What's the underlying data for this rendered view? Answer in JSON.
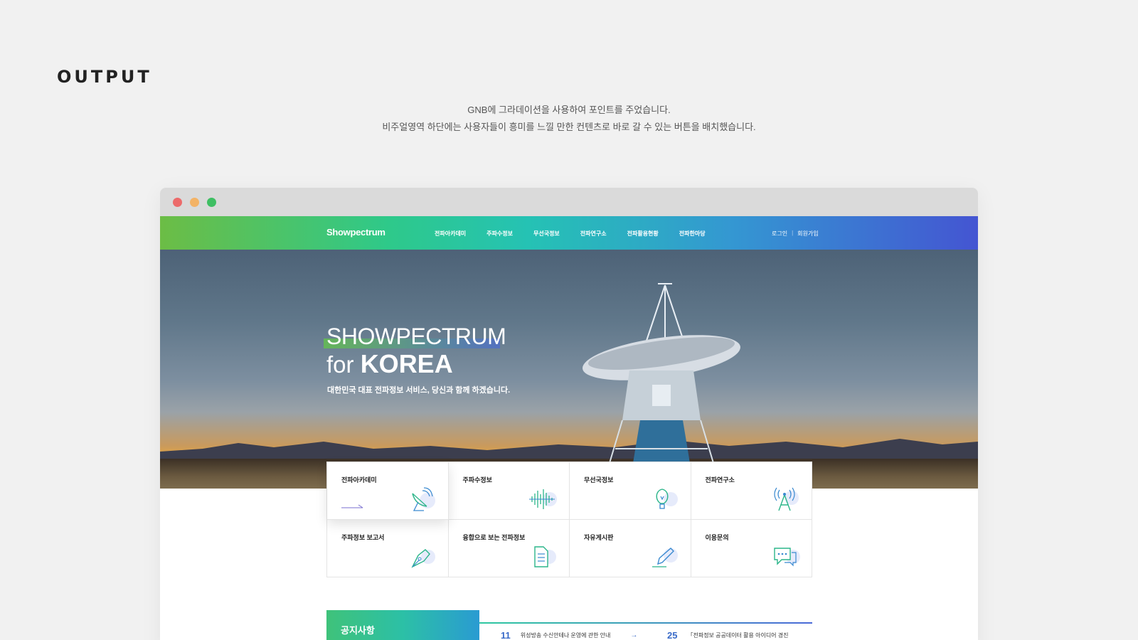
{
  "section": {
    "title": "OUTPUT",
    "desc_line1": "GNB에 그라데이션을 사용하여 포인트를 주었습니다.",
    "desc_line2": "비주얼영역 하단에는 사용자들이 흥미를 느낄 만한 컨텐츠로 바로 갈 수 있는 버튼을 배치했습니다."
  },
  "gnb": {
    "logo": "Showpectrum",
    "menu": [
      "전파아카데미",
      "주파수정보",
      "무선국정보",
      "전파연구소",
      "전파활용현황",
      "전파한마당"
    ],
    "login": "로그인",
    "separator": "|",
    "join": "회원가입"
  },
  "hero": {
    "title_line1": "SHOWPECTRUM",
    "title_for": "for ",
    "title_korea": "KOREA",
    "subtitle": "대한민국 대표 전파정보 서비스, 당신과 함께 하겠습니다."
  },
  "quick_menu": [
    {
      "label": "전파아카데미",
      "icon": "satellite-dish-icon"
    },
    {
      "label": "주파수정보",
      "icon": "waveform-icon"
    },
    {
      "label": "무선국정보",
      "icon": "lightbulb-icon"
    },
    {
      "label": "전파연구소",
      "icon": "antenna-tower-icon"
    },
    {
      "label": "주파정보 보고서",
      "icon": "pen-nib-icon"
    },
    {
      "label": "융합으로 보는 전파정보",
      "icon": "document-icon"
    },
    {
      "label": "자유게시판",
      "icon": "pencil-icon"
    },
    {
      "label": "이용문의",
      "icon": "chat-bubbles-icon"
    }
  ],
  "notice": {
    "title": "공지사항",
    "items": [
      {
        "day": "11",
        "text": "위성방송 수신안테나 운영에 관한 안내"
      },
      {
        "day": "25",
        "text": "「전파정보 공공데이터 활용 아이디어 경진"
      }
    ]
  },
  "colors": {
    "gnb_start": "#6cbd45",
    "gnb_end": "#4455d2",
    "accent_blue": "#3a6bc8"
  }
}
